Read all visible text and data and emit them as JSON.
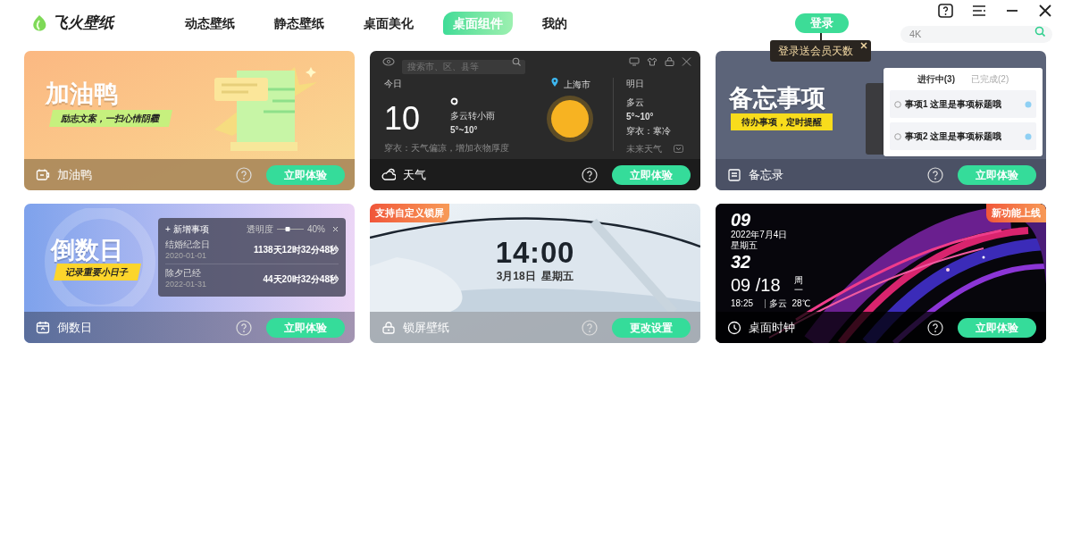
{
  "app": {
    "logo_text": "飞火壁纸"
  },
  "nav": [
    {
      "label": "动态壁纸",
      "selected": false
    },
    {
      "label": "静态壁纸",
      "selected": false
    },
    {
      "label": "桌面美化",
      "selected": false
    },
    {
      "label": "桌面组件",
      "selected": true
    },
    {
      "label": "我的",
      "selected": false
    }
  ],
  "login": {
    "label": "登录",
    "tooltip": "登录送会员天数"
  },
  "search": {
    "placeholder": "4K"
  },
  "cards": [
    {
      "kind": "fuel",
      "name": "加油鸭",
      "button": "立即体验",
      "preview": {
        "title": "加油鸭",
        "tagline": "励志文案，一扫心情阴霾"
      }
    },
    {
      "kind": "weather",
      "name": "天气",
      "button": "立即体验",
      "preview": {
        "search_placeholder": "搜索市、区、县等",
        "today_label": "今日",
        "temperature": "10",
        "condition": "多云转小雨",
        "range": "5°~10°",
        "advice": "穿衣：天气偏凉，增加衣物厚度",
        "city": "上海市",
        "tomorrow_label": "明日",
        "tomorrow_condition": "多云",
        "tomorrow_range": "5°~10°",
        "tomorrow_advice": "穿衣：寒冷",
        "forecast_link": "未来天气"
      }
    },
    {
      "kind": "memo",
      "name": "备忘录",
      "button": "立即体验",
      "preview": {
        "title": "备忘事项",
        "tagline": "待办事项，定时提醒",
        "tabs": [
          {
            "label": "进行中(3)",
            "selected": true
          },
          {
            "label": "已完成(2)",
            "selected": false
          }
        ],
        "items": [
          {
            "title": "事项1 这里是事项标题哦"
          },
          {
            "title": "事项2 这里是事项标题哦"
          }
        ]
      }
    },
    {
      "kind": "countdown",
      "name": "倒数日",
      "button": "立即体验",
      "preview": {
        "title": "倒数日",
        "tagline": "记录重要小日子",
        "add_label": "+ 新增事项",
        "opacity_label": "透明度",
        "level": 0.4,
        "opacity_value": "40%",
        "events": [
          {
            "name": "结婚纪念日",
            "date": "2020-01-01",
            "elapsed": "1138天12时32分48秒"
          },
          {
            "name": "除夕已经",
            "date": "2022-01-31",
            "elapsed": "44天20时32分48秒"
          }
        ]
      }
    },
    {
      "kind": "lockscreen",
      "name": "锁屏壁纸",
      "button": "更改设置",
      "preview": {
        "badge": "支持自定义锁屏",
        "time": "14:00",
        "date": "3月18日  星期五"
      }
    },
    {
      "kind": "clock",
      "name": "桌面时钟",
      "button": "立即体验",
      "preview": {
        "badge": "新功能上线",
        "hour": "09",
        "date_small": "2022年7月4日",
        "weekday_small": "星期五",
        "minute": "32",
        "day_big": "09 /18",
        "weekday_big": "周一",
        "time_small": "18:25",
        "weather_small": "多云  28℃"
      }
    }
  ]
}
